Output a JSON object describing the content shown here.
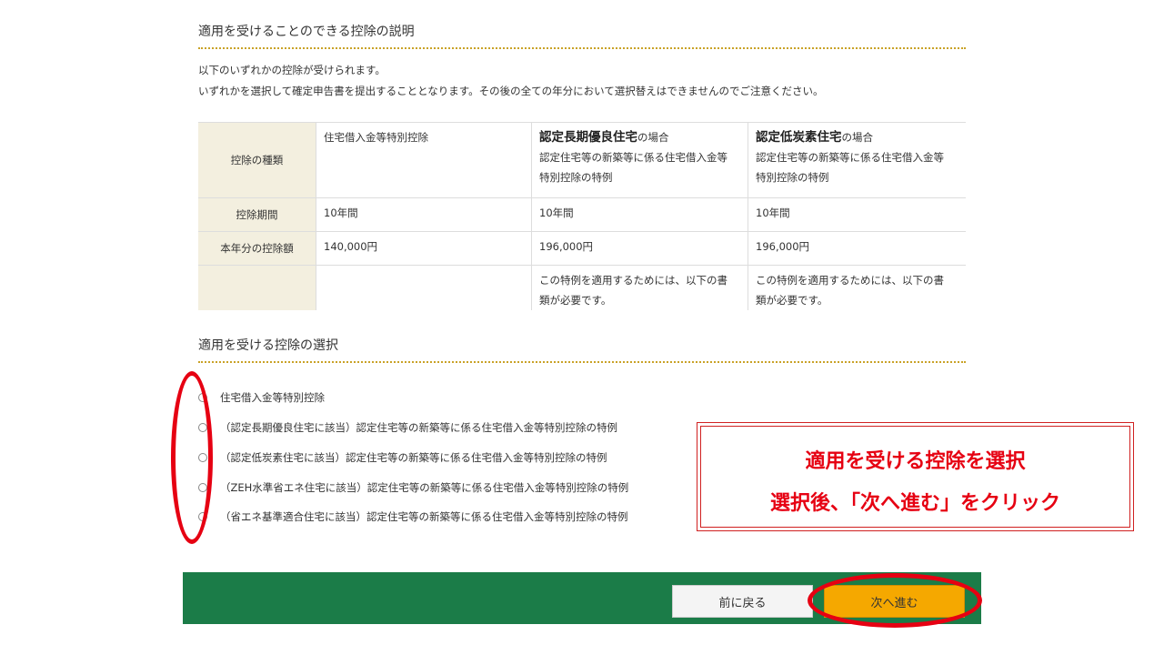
{
  "section1": {
    "title": "適用を受けることのできる控除の説明",
    "intro_line1": "以下のいずれかの控除が受けられます。",
    "intro_line2": "いずれかを選択して確定申告書を提出することとなります。その後の全ての年分において選択替えはできませんのでご注意ください。"
  },
  "table": {
    "row_headers": [
      "控除の種類",
      "控除期間",
      "本年分の控除額"
    ],
    "col1": {
      "type": "住宅借入金等特別控除",
      "period": "10年間",
      "amount": "140,000円",
      "note": ""
    },
    "col2": {
      "type_bold": "認定長期優良住宅",
      "type_suffix": "の場合",
      "type_line2": "認定住宅等の新築等に係る住宅借入金等",
      "type_line3": "特別控除の特例",
      "period": "10年間",
      "amount": "196,000円",
      "note_line1": "この特例を適用するためには、以下の書",
      "note_line2": "類が必要です。"
    },
    "col3": {
      "type_bold": "認定低炭素住宅",
      "type_suffix": "の場合",
      "type_line2": "認定住宅等の新築等に係る住宅借入金等",
      "type_line3": "特別控除の特例",
      "period": "10年間",
      "amount": "196,000円",
      "note_line1": "この特例を適用するためには、以下の書",
      "note_line2": "類が必要です。"
    }
  },
  "section2": {
    "title": "適用を受ける控除の選択",
    "options": [
      "住宅借入金等特別控除",
      "（認定長期優良住宅に該当）認定住宅等の新築等に係る住宅借入金等特別控除の特例",
      "（認定低炭素住宅に該当）認定住宅等の新築等に係る住宅借入金等特別控除の特例",
      "（ZEH水準省エネ住宅に該当）認定住宅等の新築等に係る住宅借入金等特別控除の特例",
      "（省エネ基準適合住宅に該当）認定住宅等の新築等に係る住宅借入金等特別控除の特例"
    ]
  },
  "callout": {
    "line1": "適用を受ける控除を選択",
    "line2": "選択後、「次へ進む」をクリック"
  },
  "buttons": {
    "back": "前に戻る",
    "next": "次へ進む"
  },
  "colors": {
    "accent_bar": "#1b7c48",
    "next_button": "#f5a800",
    "annotation_red": "#e60012",
    "table_header_bg": "#f3efdf",
    "section_rule": "#c9a227"
  }
}
